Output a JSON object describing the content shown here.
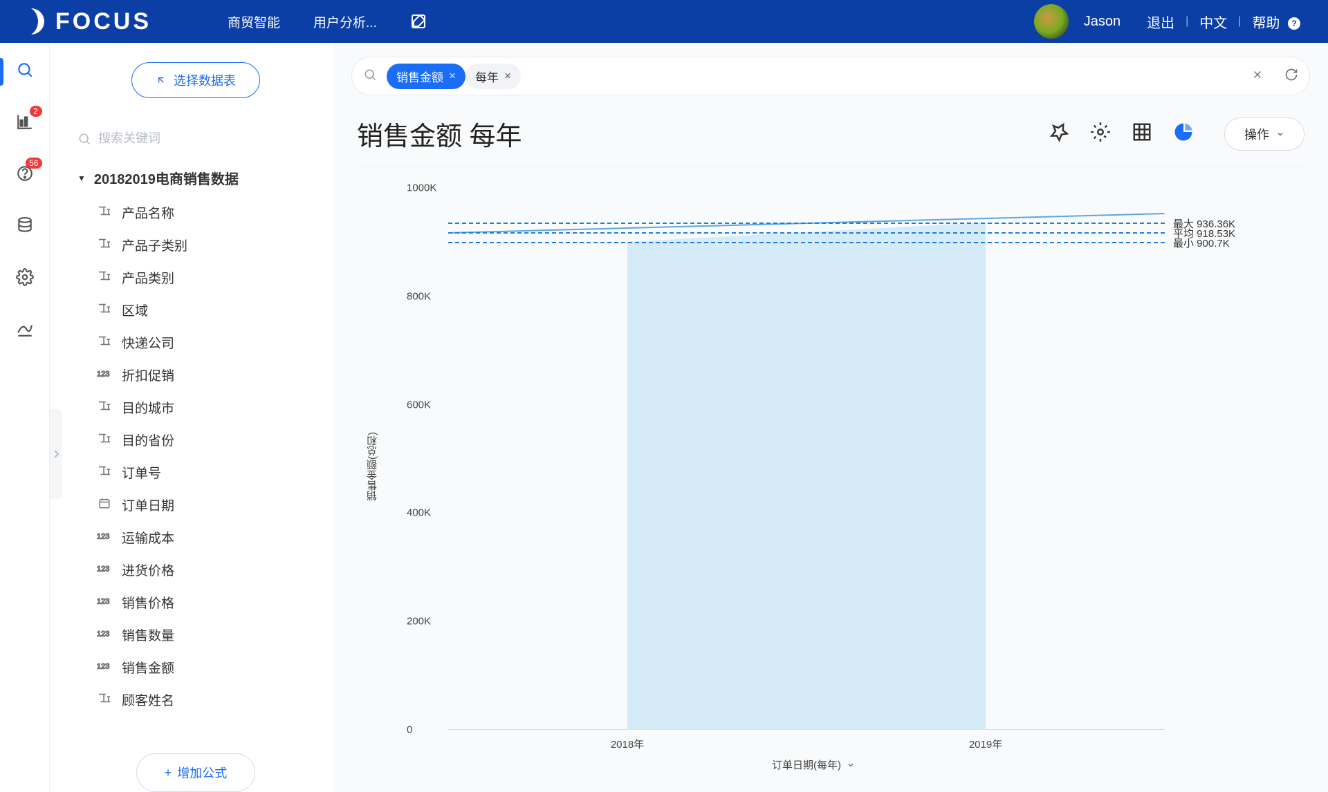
{
  "brand": {
    "name": "FOCUS"
  },
  "header": {
    "nav": [
      "商贸智能",
      "用户分析..."
    ],
    "user": "Jason",
    "links": {
      "logout": "退出",
      "lang": "中文",
      "help": "帮助"
    }
  },
  "rail": {
    "badges": {
      "chart": "2",
      "question": "56"
    }
  },
  "left_panel": {
    "select_table": "选择数据表",
    "search_placeholder": "搜索关键词",
    "dataset_title": "20182019电商销售数据",
    "fields": [
      {
        "type": "text",
        "label": "产品名称"
      },
      {
        "type": "text",
        "label": "产品子类别"
      },
      {
        "type": "text",
        "label": "产品类别"
      },
      {
        "type": "text",
        "label": "区域"
      },
      {
        "type": "text",
        "label": "快递公司"
      },
      {
        "type": "num",
        "label": "折扣促销"
      },
      {
        "type": "text",
        "label": "目的城市"
      },
      {
        "type": "text",
        "label": "目的省份"
      },
      {
        "type": "text",
        "label": "订单号"
      },
      {
        "type": "date",
        "label": "订单日期"
      },
      {
        "type": "num",
        "label": "运输成本"
      },
      {
        "type": "num",
        "label": "进货价格"
      },
      {
        "type": "num",
        "label": "销售价格"
      },
      {
        "type": "num",
        "label": "销售数量"
      },
      {
        "type": "num",
        "label": "销售金额"
      },
      {
        "type": "text",
        "label": "顾客姓名"
      }
    ],
    "add_formula": "增加公式"
  },
  "query_bar": {
    "pills": [
      {
        "style": "blue",
        "label": "销售金额"
      },
      {
        "style": "light",
        "label": "每年"
      }
    ]
  },
  "page": {
    "title": "销售金额 每年",
    "ops_label": "操作"
  },
  "chart_data": {
    "type": "area",
    "x": [
      "2018年",
      "2019年"
    ],
    "values": [
      900700,
      936360
    ],
    "reference_lines": [
      {
        "label": "最大 936.36K",
        "value": 936360
      },
      {
        "label": "平均 918.53K",
        "value": 918530
      },
      {
        "label": "最小 900.7K",
        "value": 900700
      }
    ],
    "ylabel": "销售金额(总和)",
    "xlabel": "订单日期(每年)",
    "ylim": [
      0,
      1000000
    ],
    "yticks": [
      {
        "v": 0,
        "label": "0"
      },
      {
        "v": 200000,
        "label": "200K"
      },
      {
        "v": 400000,
        "label": "400K"
      },
      {
        "v": 600000,
        "label": "600K"
      },
      {
        "v": 800000,
        "label": "800K"
      },
      {
        "v": 1000000,
        "label": "1000K"
      }
    ]
  }
}
